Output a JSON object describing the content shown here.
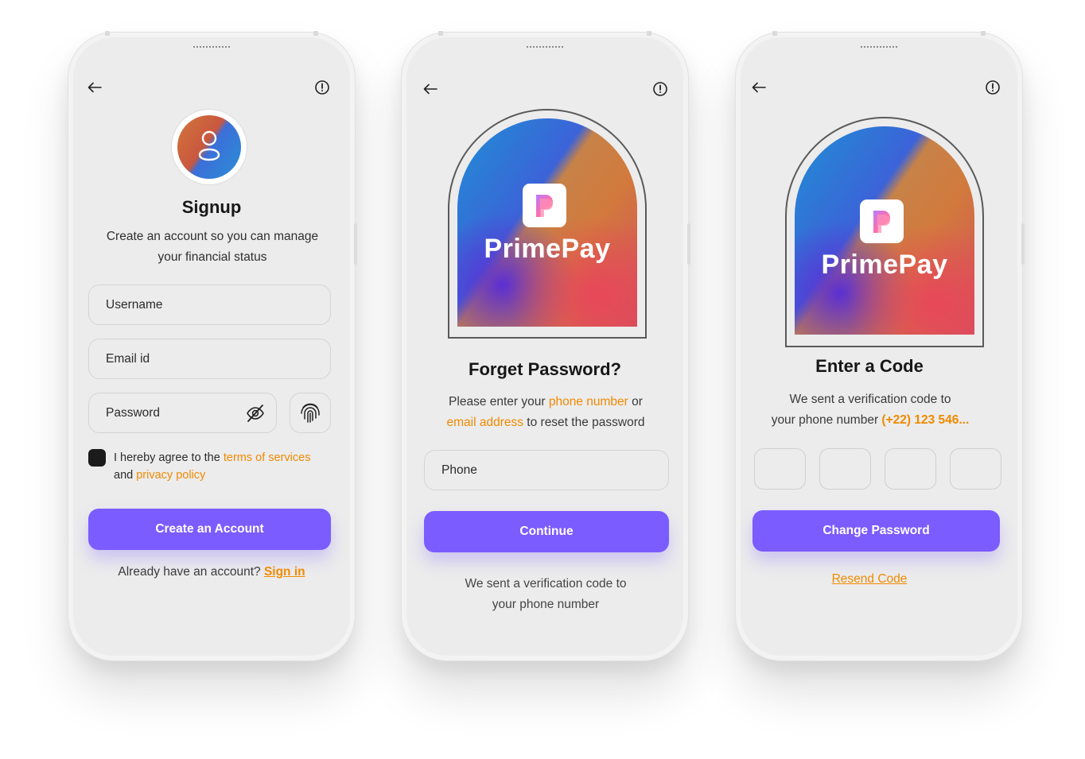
{
  "screen1": {
    "title": "Signup",
    "subtitle_line1": "Create an account so you can manage",
    "subtitle_line2": "your financial status",
    "username_placeholder": "Username",
    "email_placeholder": "Email id",
    "password_placeholder": "Password",
    "agree_prefix": "I hereby agree to the",
    "terms_link": "terms of services",
    "and_text": "and",
    "privacy_link": "privacy policy",
    "cta_label": "Create an Account",
    "have_account_text": "Already have an account?",
    "signin_link": "Sign in"
  },
  "screen2": {
    "brand_name": "PrimePay",
    "title": "Forget Password?",
    "instruction_prefix": "Please enter your",
    "phone_link": "phone number",
    "or_text": "or",
    "email_link": "email address",
    "instruction_suffix": "to reset the password",
    "phone_placeholder": "Phone",
    "cta_label": "Continue",
    "footer_line1": "We sent a verification code to",
    "footer_line2": "your phone number"
  },
  "screen3": {
    "brand_name": "PrimePay",
    "title": "Enter a Code",
    "sent_line1": "We sent a verification code to",
    "sent_prefix": "your phone number",
    "phone_number": "(+22) 123 546...",
    "cta_label": "Change Password",
    "resend_link": "Resend Code"
  },
  "icons": {
    "back": "arrow-left-icon",
    "info": "alert-circle-icon",
    "avatar": "user-icon",
    "password_toggle": "eye-off-icon",
    "biometric": "fingerprint-icon",
    "checkbox": "checkbox-checked",
    "logo": "primepay-logo-icon"
  },
  "colors": {
    "accent": "#7b5cff",
    "link": "#f08a00",
    "background": "#ececec"
  }
}
